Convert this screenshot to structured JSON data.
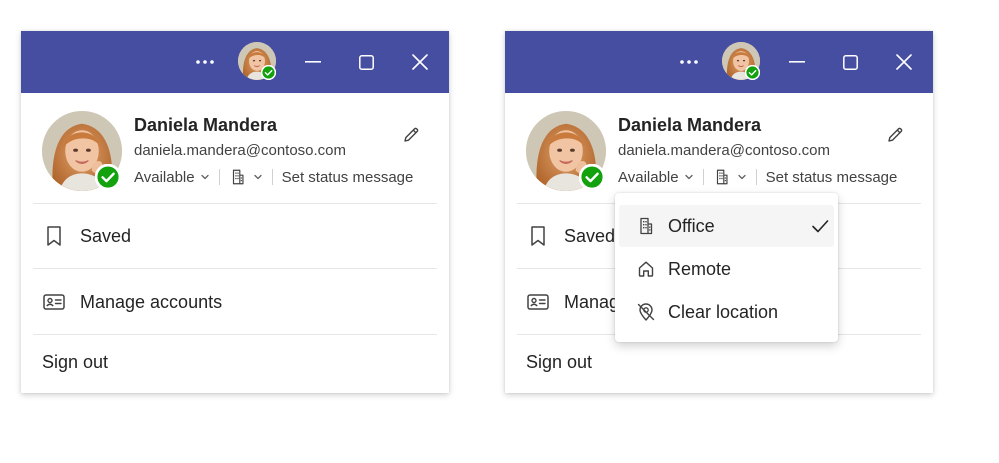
{
  "colors": {
    "titlebar": "#464ea1",
    "presence_available": "#13a10e",
    "text_primary": "#242424",
    "text_secondary": "#424242"
  },
  "titlebar": {
    "icons": [
      "more-icon",
      "avatar",
      "minimize-icon",
      "maximize-icon",
      "close-icon"
    ]
  },
  "profile": {
    "name": "Daniela Mandera",
    "email": "daniela.mandera@contoso.com",
    "presence": "Available",
    "location_icon": "building-icon",
    "status_message": "Set status message",
    "edit_icon": "pencil-icon"
  },
  "menu": {
    "saved": "Saved",
    "manage_accounts": "Manage accounts",
    "sign_out": "Sign out"
  },
  "right_panel": {
    "saved_truncated": "Saved",
    "manage_truncated": "Manag"
  },
  "location_dropdown": {
    "items": [
      {
        "label": "Office",
        "icon": "building-icon",
        "selected": true
      },
      {
        "label": "Remote",
        "icon": "home-icon",
        "selected": false
      },
      {
        "label": "Clear location",
        "icon": "location-off-icon",
        "selected": false
      }
    ]
  }
}
